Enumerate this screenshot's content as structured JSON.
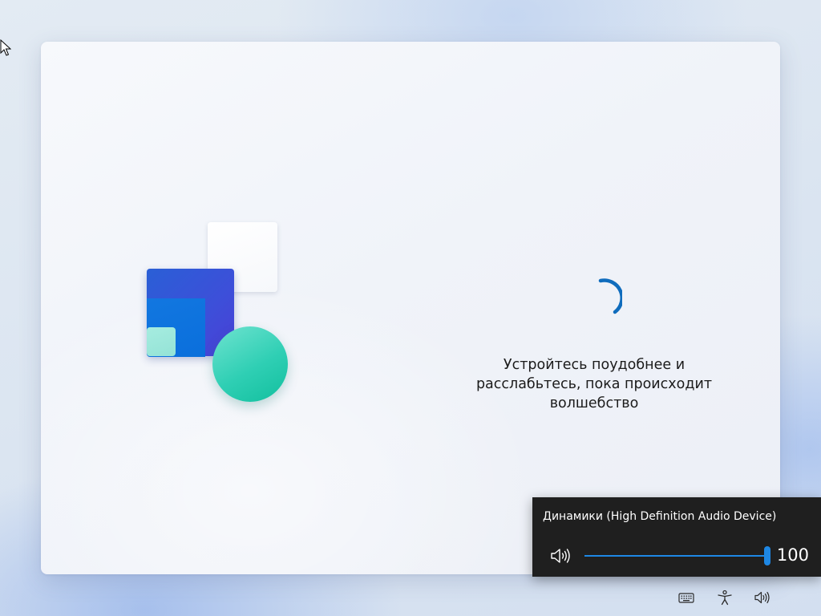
{
  "oobe": {
    "message": "Устройтесь поудобнее и расслабьтесь, пока происходит волшебство",
    "spinner": "loading-spinner"
  },
  "volume_flyout": {
    "device_name": "Динамики (High Definition Audio Device)",
    "volume_level": "100",
    "volume_fraction": 1.0,
    "speaker_icon": "speaker-icon",
    "accent_color": "#1e88e5"
  },
  "tray": {
    "icons": [
      "keyboard-icon",
      "accessibility-icon",
      "speaker-icon"
    ]
  }
}
